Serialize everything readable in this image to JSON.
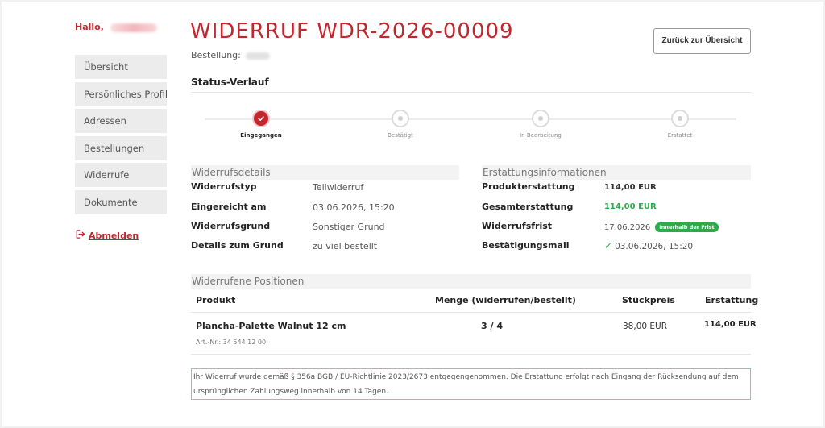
{
  "sidebar": {
    "greeting": "Hallo,",
    "items": [
      {
        "label": "Übersicht"
      },
      {
        "label": "Persönliches Profil"
      },
      {
        "label": "Adressen"
      },
      {
        "label": "Bestellungen"
      },
      {
        "label": "Widerrufe"
      },
      {
        "label": "Dokumente"
      }
    ],
    "logout_label": "Abmelden"
  },
  "header": {
    "title": "WIDERRUF WDR-2026-00009",
    "order_label": "Bestellung:",
    "back_button": "Zurück zur Übersicht"
  },
  "status": {
    "heading": "Status-Verlauf",
    "steps": [
      {
        "label": "Eingegangen",
        "state": "done"
      },
      {
        "label": "Bestätigt",
        "state": "pending"
      },
      {
        "label": "In Bearbeitung",
        "state": "pending"
      },
      {
        "label": "Erstattet",
        "state": "pending"
      }
    ]
  },
  "details": {
    "heading": "Widerrufsdetails",
    "rows": [
      {
        "label": "Widerrufstyp",
        "value": "Teilwiderruf"
      },
      {
        "label": "Eingereicht am",
        "value": "03.06.2026, 15:20"
      },
      {
        "label": "Widerrufsgrund",
        "value": "Sonstiger Grund"
      },
      {
        "label": "Details zum Grund",
        "value": "zu viel bestellt"
      }
    ]
  },
  "refund": {
    "heading": "Erstattungsinformationen",
    "rows": [
      {
        "label": "Produkterstattung",
        "value": "114,00 EUR"
      },
      {
        "label": "Gesamterstattung",
        "value": "114,00 EUR"
      },
      {
        "label": "Widerrufsfrist",
        "value": "17.06.2026",
        "badge": "Innerhalb der Frist"
      },
      {
        "label": "Bestätigungsmail",
        "value": "03.06.2026, 15:20",
        "check": "✓"
      }
    ]
  },
  "positions": {
    "heading": "Widerrufene Positionen",
    "columns": [
      "Produkt",
      "Menge (widerrufen/bestellt)",
      "Stückpreis",
      "Erstattung"
    ],
    "rows": [
      {
        "product": "Plancha-Palette Walnut 12 cm",
        "article": "Art.-Nr.: 34 544 12 00",
        "quantity": "3 / 4",
        "unit_price": "38,00 EUR",
        "refund": "114,00 EUR"
      }
    ]
  },
  "notice": "Ihr Widerruf wurde gemäß § 356a BGB / EU-Richtlinie 2023/2673 entgegengenommen. Die Erstattung erfolgt nach Eingang der Rücksendung auf dem ursprünglichen Zahlungsweg innerhalb von 14 Tagen.",
  "colors": {
    "accent": "#c4262e",
    "success": "#2eaa4a",
    "notice_border": "#7cc6d6"
  }
}
